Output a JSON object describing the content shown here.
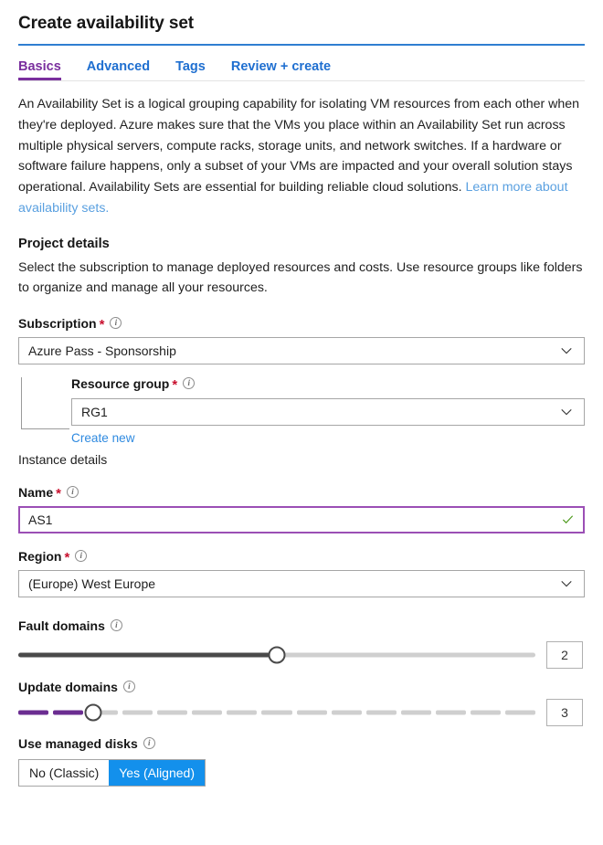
{
  "header": {
    "title": "Create availability set"
  },
  "tabs": [
    {
      "label": "Basics",
      "active": true
    },
    {
      "label": "Advanced",
      "active": false
    },
    {
      "label": "Tags",
      "active": false
    },
    {
      "label": "Review + create",
      "active": false
    }
  ],
  "intro": {
    "text": "An Availability Set is a logical grouping capability for isolating VM resources from each other when they're deployed. Azure makes sure that the VMs you place within an Availability Set run across multiple physical servers, compute racks, storage units, and network switches. If a hardware or software failure happens, only a subset of your VMs are impacted and your overall solution stays operational. Availability Sets are essential for building reliable cloud solutions.",
    "link_text": "Learn more about availability sets."
  },
  "project_details": {
    "heading": "Project details",
    "description": "Select the subscription to manage deployed resources and costs. Use resource groups like folders to organize and manage all your resources.",
    "subscription": {
      "label": "Subscription",
      "required_mark": "*",
      "value": "Azure Pass - Sponsorship"
    },
    "resource_group": {
      "label": "Resource group",
      "required_mark": "*",
      "value": "RG1",
      "create_new_label": "Create new"
    }
  },
  "instance_details": {
    "heading": "Instance details",
    "name": {
      "label": "Name",
      "required_mark": "*",
      "value": "AS1",
      "valid": true
    },
    "region": {
      "label": "Region",
      "required_mark": "*",
      "value": "(Europe) West Europe"
    },
    "fault_domains": {
      "label": "Fault domains",
      "value": "2",
      "min": 1,
      "max": 3,
      "fill_percent": 50
    },
    "update_domains": {
      "label": "Update domains",
      "value": "3",
      "min": 1,
      "max": 20,
      "segments": 15,
      "filled_segments": 2,
      "thumb_percent": 14.5
    },
    "managed_disks": {
      "label": "Use managed disks",
      "options": [
        {
          "label": "No (Classic)",
          "selected": false
        },
        {
          "label": "Yes (Aligned)",
          "selected": true
        }
      ]
    }
  },
  "colors": {
    "accent_blue": "#2f7ed1",
    "tab_active_purple": "#7a2f9e",
    "link_blue": "#5aa0e0",
    "toggle_selected_blue": "#1390ec",
    "slider_purple": "#6b2d91",
    "required_red": "#c8102e",
    "valid_green": "#4f9b1f"
  },
  "icons": {
    "info": "info-icon",
    "chevron_down": "chevron-down-icon",
    "check": "check-icon"
  }
}
